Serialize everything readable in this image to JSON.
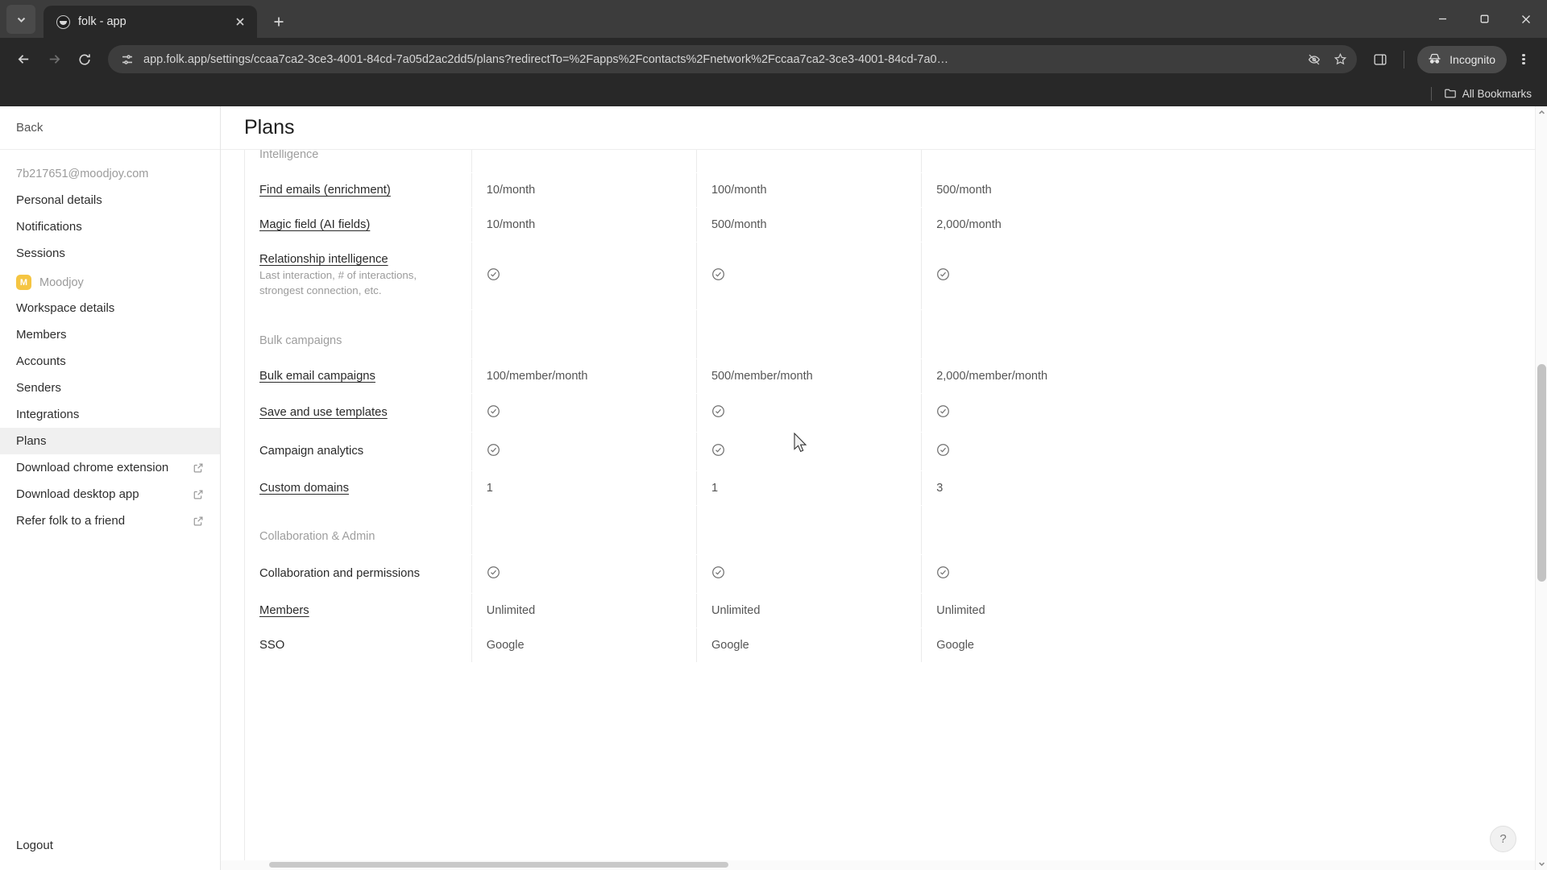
{
  "browser": {
    "tab": {
      "title": "folk - app",
      "favicon_icon": "folk-circle-icon",
      "close_icon": "close-icon"
    },
    "tab_list_icon": "chevron-down-icon",
    "new_tab_icon": "plus-icon",
    "window_controls": {
      "minimize_icon": "minimize-icon",
      "maximize_icon": "maximize-icon",
      "close_icon": "window-close-icon"
    },
    "nav": {
      "back_icon": "arrow-left-icon",
      "forward_icon": "arrow-right-icon",
      "reload_icon": "reload-icon"
    },
    "omnibox": {
      "site_info_icon": "tune-settings-icon",
      "url": "app.folk.app/settings/ccaa7ca2-3ce3-4001-84cd-7a05d2ac2dd5/plans?redirectTo=%2Fapps%2Fcontacts%2Fnetwork%2Fccaa7ca2-3ce3-4001-84cd-7a0…",
      "placeholder": "Search Google or type a URL",
      "tracking_icon": "eye-off-icon",
      "bookmark_icon": "star-icon"
    },
    "side_panel_icon": "side-panel-icon",
    "incognito": {
      "label": "Incognito",
      "icon": "incognito-icon"
    },
    "menu_icon": "three-dots-vertical-icon",
    "bookmarks": {
      "label": "All Bookmarks",
      "icon": "folder-icon"
    }
  },
  "sidebar": {
    "back": {
      "label": "Back"
    },
    "account_email": "7b217651@moodjoy.com",
    "account_items": [
      {
        "label": "Personal details",
        "external": false
      },
      {
        "label": "Notifications",
        "external": false
      },
      {
        "label": "Sessions",
        "external": false
      }
    ],
    "workspace": {
      "name": "Moodjoy",
      "avatar_letter": "M",
      "avatar_color": "#f5c542"
    },
    "workspace_items": [
      {
        "label": "Workspace details",
        "external": false,
        "active": false
      },
      {
        "label": "Members",
        "external": false,
        "active": false
      },
      {
        "label": "Accounts",
        "external": false,
        "active": false
      },
      {
        "label": "Senders",
        "external": false,
        "active": false
      },
      {
        "label": "Integrations",
        "external": false,
        "active": false
      },
      {
        "label": "Plans",
        "external": false,
        "active": true
      },
      {
        "label": "Download chrome extension",
        "external": true,
        "active": false
      },
      {
        "label": "Download desktop app",
        "external": true,
        "active": false
      },
      {
        "label": "Refer folk to a friend",
        "external": true,
        "active": false
      }
    ],
    "logout": {
      "label": "Logout"
    }
  },
  "page": {
    "title": "Plans",
    "help_button": {
      "label": "?"
    }
  },
  "plans_table": {
    "check_icon": "check-circle-icon",
    "sections": [
      {
        "name": "Intelligence",
        "rows": [
          {
            "feature": "Find emails (enrichment)",
            "linked": true,
            "sub": "",
            "values": [
              "10/month",
              "100/month",
              "500/month"
            ]
          },
          {
            "feature": "Magic field (AI fields)",
            "linked": true,
            "sub": "",
            "values": [
              "10/month",
              "500/month",
              "2,000/month"
            ]
          },
          {
            "feature": "Relationship intelligence",
            "linked": true,
            "sub": "Last interaction, # of interactions, strongest connection, etc.",
            "values": [
              "check",
              "check",
              "check"
            ]
          }
        ]
      },
      {
        "name": "Bulk campaigns",
        "rows": [
          {
            "feature": "Bulk email campaigns",
            "linked": true,
            "sub": "",
            "values": [
              "100/member/month",
              "500/member/month",
              "2,000/member/month"
            ]
          },
          {
            "feature": "Save and use templates",
            "linked": true,
            "sub": "",
            "values": [
              "check",
              "check",
              "check"
            ]
          },
          {
            "feature": "Campaign analytics",
            "linked": false,
            "sub": "",
            "values": [
              "check",
              "check",
              "check"
            ]
          },
          {
            "feature": "Custom domains",
            "linked": true,
            "sub": "",
            "values": [
              "1",
              "1",
              "3"
            ]
          }
        ]
      },
      {
        "name": "Collaboration & Admin",
        "rows": [
          {
            "feature": "Collaboration and permissions",
            "linked": false,
            "sub": "",
            "values": [
              "check",
              "check",
              "check"
            ]
          },
          {
            "feature": "Members",
            "linked": true,
            "sub": "",
            "values": [
              "Unlimited",
              "Unlimited",
              "Unlimited"
            ]
          },
          {
            "feature": "SSO",
            "linked": false,
            "sub": "",
            "values": [
              "Google",
              "Google",
              "Google"
            ]
          }
        ]
      }
    ]
  },
  "scrollbars": {
    "vertical_up_icon": "chevron-up-icon",
    "vertical_down_icon": "chevron-down-icon"
  }
}
